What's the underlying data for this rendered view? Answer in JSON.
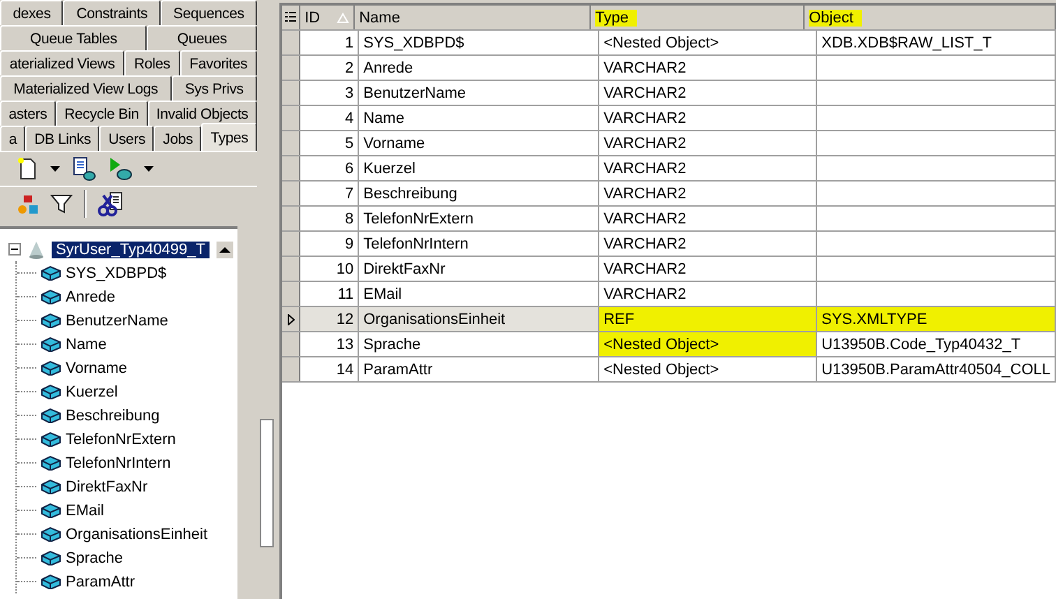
{
  "tab_rows": [
    [
      {
        "label": "dexes",
        "selected": false
      },
      {
        "label": "Constraints",
        "selected": false
      },
      {
        "label": "Sequences",
        "selected": false
      }
    ],
    [
      {
        "label": "Queue Tables",
        "selected": false
      },
      {
        "label": "Queues",
        "selected": false
      }
    ],
    [
      {
        "label": "aterialized Views",
        "selected": false
      },
      {
        "label": "Roles",
        "selected": false
      },
      {
        "label": "Favorites",
        "selected": false
      }
    ],
    [
      {
        "label": "Materialized View Logs",
        "selected": false
      },
      {
        "label": "Sys Privs",
        "selected": false
      }
    ],
    [
      {
        "label": "asters",
        "selected": false
      },
      {
        "label": "Recycle Bin",
        "selected": false
      },
      {
        "label": "Invalid Objects",
        "selected": false
      }
    ],
    [
      {
        "label": "a",
        "selected": false
      },
      {
        "label": "DB Links",
        "selected": false
      },
      {
        "label": "Users",
        "selected": false
      },
      {
        "label": "Jobs",
        "selected": false
      },
      {
        "label": "Types",
        "selected": true
      }
    ]
  ],
  "tree": {
    "label": "SyrUser_Typ40499_T",
    "expanded": true,
    "selected": true,
    "children": [
      {
        "label": "SYS_XDBPD$"
      },
      {
        "label": "Anrede"
      },
      {
        "label": "BenutzerName"
      },
      {
        "label": "Name"
      },
      {
        "label": "Vorname"
      },
      {
        "label": "Kuerzel"
      },
      {
        "label": "Beschreibung"
      },
      {
        "label": "TelefonNrExtern"
      },
      {
        "label": "TelefonNrIntern"
      },
      {
        "label": "DirektFaxNr"
      },
      {
        "label": "EMail"
      },
      {
        "label": "OrganisationsEinheit"
      },
      {
        "label": "Sprache"
      },
      {
        "label": "ParamAttr"
      }
    ]
  },
  "table": {
    "columns": [
      {
        "label": "ID",
        "highlighted": false
      },
      {
        "label": "Name",
        "highlighted": false
      },
      {
        "label": "Type",
        "highlighted": true
      },
      {
        "label": "Object",
        "highlighted": true
      }
    ],
    "rows": [
      {
        "id": "1",
        "name": "SYS_XDBPD$",
        "type": "<Nested Object>",
        "object": "XDB.XDB$RAW_LIST_T",
        "selected": false,
        "type_highlighted": false,
        "object_highlighted": false
      },
      {
        "id": "2",
        "name": "Anrede",
        "type": "VARCHAR2",
        "selected": false,
        "type_highlighted": false,
        "object_highlighted": false
      },
      {
        "id": "3",
        "name": "BenutzerName",
        "type": "VARCHAR2",
        "selected": false,
        "type_highlighted": false,
        "object_highlighted": false
      },
      {
        "id": "4",
        "name": "Name",
        "type": "VARCHAR2",
        "selected": false,
        "type_highlighted": false,
        "object_highlighted": false
      },
      {
        "id": "5",
        "name": "Vorname",
        "type": "VARCHAR2",
        "selected": false,
        "type_highlighted": false,
        "object_highlighted": false
      },
      {
        "id": "6",
        "name": "Kuerzel",
        "type": "VARCHAR2",
        "selected": false,
        "type_highlighted": false,
        "object_highlighted": false
      },
      {
        "id": "7",
        "name": "Beschreibung",
        "type": "VARCHAR2",
        "selected": false,
        "type_highlighted": false,
        "object_highlighted": false
      },
      {
        "id": "8",
        "name": "TelefonNrExtern",
        "type": "VARCHAR2",
        "selected": false,
        "type_highlighted": false,
        "object_highlighted": false
      },
      {
        "id": "9",
        "name": "TelefonNrIntern",
        "type": "VARCHAR2",
        "selected": false,
        "type_highlighted": false,
        "object_highlighted": false
      },
      {
        "id": "10",
        "name": "DirektFaxNr",
        "type": "VARCHAR2",
        "selected": false,
        "type_highlighted": false,
        "object_highlighted": false
      },
      {
        "id": "11",
        "name": "EMail",
        "type": "VARCHAR2",
        "selected": false,
        "type_highlighted": false,
        "object_highlighted": false
      },
      {
        "id": "12",
        "name": "OrganisationsEinheit",
        "type": "REF",
        "object": "SYS.XMLTYPE",
        "selected": true,
        "type_highlighted": true,
        "object_highlighted": true
      },
      {
        "id": "13",
        "name": "Sprache",
        "type": "<Nested Object>",
        "object": "U13950B.Code_Typ40432_T",
        "selected": false,
        "type_highlighted": true,
        "object_highlighted": false
      },
      {
        "id": "14",
        "name": "ParamAttr",
        "type": "<Nested Object>",
        "object": "U13950B.ParamAttr40504_COLL",
        "selected": false,
        "type_highlighted": false,
        "object_highlighted": false
      }
    ]
  }
}
